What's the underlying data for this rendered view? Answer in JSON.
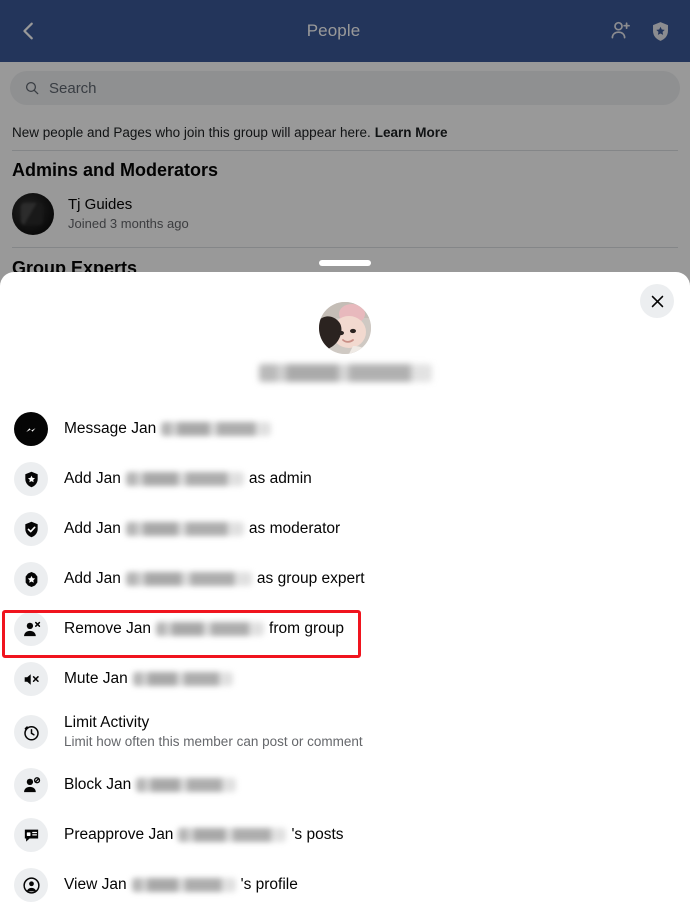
{
  "background_screen": {
    "topbar": {
      "back_icon": "chevron-left-icon",
      "title": "People",
      "actions": [
        {
          "icon": "add-person-icon",
          "label": "Add member"
        },
        {
          "icon": "shield-star-icon",
          "label": "Admin tools"
        }
      ],
      "color": "#3b5998"
    },
    "search": {
      "icon": "search-icon",
      "placeholder": "Search",
      "value": ""
    },
    "notice": {
      "text": "New people and Pages who join this group will appear here.",
      "link_label": "Learn More"
    },
    "sections": [
      {
        "title": "Admins and Moderators",
        "members": [
          {
            "name": "Tj Guides",
            "subtitle": "Joined 3 months ago",
            "avatar": "group-page-avatar"
          }
        ]
      },
      {
        "title": "Group Experts",
        "members": []
      }
    ]
  },
  "sheet": {
    "drag_handle": "sheet-drag-handle",
    "close_icon": "close-icon",
    "profile": {
      "avatar": "member-profile-photo",
      "name_redacted": true,
      "name": ""
    },
    "menu_items": [
      {
        "id": "message",
        "icon": "messenger-icon",
        "prefix": "Message Jan",
        "redacted": true,
        "suffix": "",
        "subtitle": ""
      },
      {
        "id": "add-admin",
        "icon": "shield-star-icon",
        "prefix": "Add Jan",
        "redacted": true,
        "suffix": "as admin",
        "subtitle": ""
      },
      {
        "id": "add-moderator",
        "icon": "shield-check-icon",
        "prefix": "Add Jan",
        "redacted": true,
        "suffix": "as moderator",
        "subtitle": ""
      },
      {
        "id": "add-group-expert",
        "icon": "badge-star-icon",
        "prefix": "Add Jan",
        "redacted": true,
        "suffix": "as group expert",
        "subtitle": ""
      },
      {
        "id": "remove-from-group",
        "icon": "person-remove-icon",
        "prefix": "Remove Jan",
        "redacted": true,
        "suffix": "from group",
        "subtitle": "",
        "highlighted": true
      },
      {
        "id": "mute",
        "icon": "speaker-mute-icon",
        "prefix": "Mute Jan",
        "redacted": true,
        "suffix": "",
        "subtitle": ""
      },
      {
        "id": "limit-activity",
        "icon": "timer-icon",
        "prefix": "Limit Activity",
        "redacted": false,
        "suffix": "",
        "subtitle": "Limit how often this member can post or comment"
      },
      {
        "id": "block",
        "icon": "person-block-icon",
        "prefix": "Block Jan",
        "redacted": true,
        "suffix": "",
        "subtitle": ""
      },
      {
        "id": "preapprove-posts",
        "icon": "comment-approve-icon",
        "prefix": "Preapprove Jan",
        "redacted": true,
        "suffix": "'s posts",
        "subtitle": ""
      },
      {
        "id": "view-profile",
        "icon": "profile-circle-icon",
        "prefix": "View Jan",
        "redacted": true,
        "suffix": "'s profile",
        "subtitle": ""
      }
    ]
  },
  "annotation": {
    "highlight_color": "#f0141e",
    "target_item": "remove-from-group"
  }
}
